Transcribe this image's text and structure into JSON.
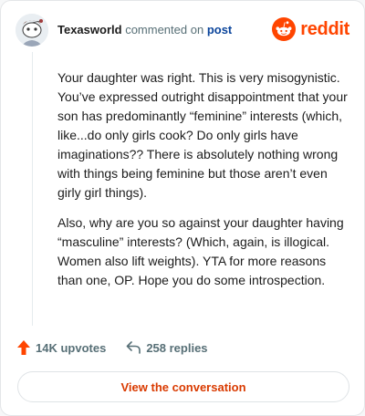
{
  "header": {
    "username": "Texasworld",
    "commented_text": "commented on",
    "post_link": "post",
    "brand": "reddit"
  },
  "comment": {
    "paragraphs": [
      "Your daughter was right. This is very misogynistic. You’ve expressed outright disappointment that your son has predominantly “feminine” interests (which, like...do only girls cook? Do only girls have imaginations?? There is absolutely nothing wrong with things being feminine but those aren’t even girly girl things).",
      "Also, why are you so against your daughter having “masculine” interests? (Which, again, is illogical. Women also lift weights). YTA for more reasons than one, OP. Hope you do some introspection."
    ]
  },
  "actions": {
    "upvotes": "14K upvotes",
    "replies": "258 replies"
  },
  "cta": {
    "label": "View the conversation"
  },
  "colors": {
    "brand": "#ff4500",
    "cta_text": "#d93a00",
    "link": "#0a449b"
  }
}
